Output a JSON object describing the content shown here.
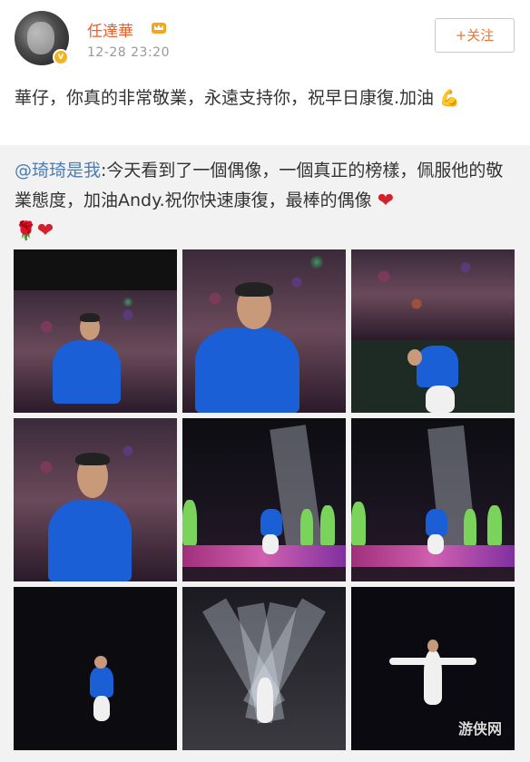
{
  "header": {
    "username": "任達華",
    "time": "12-28 23:20",
    "follow_label": "+关注",
    "verified_badge": "v",
    "crown_icon": "crown-icon"
  },
  "post": {
    "text": "華仔，你真的非常敬業，永遠支持你，祝早日康復.加油",
    "emoji": "💪"
  },
  "repost": {
    "mention": "@琦琦是我",
    "text": ":今天看到了一個偶像，一個真正的榜樣，佩服他的敬業態度，加油Andy.祝你快速康復，最棒的偶像",
    "heart": "❤",
    "rose": "🌹",
    "heart2": "❤"
  },
  "photos": [
    {
      "name": "photo-1",
      "scene": "blue-jacket-crowd"
    },
    {
      "name": "photo-2",
      "scene": "blue-jacket-closeup"
    },
    {
      "name": "photo-3",
      "scene": "bowing"
    },
    {
      "name": "photo-4",
      "scene": "praying-hands"
    },
    {
      "name": "photo-5",
      "scene": "stage-dancers"
    },
    {
      "name": "photo-6",
      "scene": "stage-dancers-2"
    },
    {
      "name": "photo-7",
      "scene": "dark-stage"
    },
    {
      "name": "photo-8",
      "scene": "spotlights"
    },
    {
      "name": "photo-9",
      "scene": "arms-spread"
    }
  ],
  "watermark": "游侠网",
  "colors": {
    "username": "#e8612c",
    "follow": "#ec7630",
    "mention": "#4f7cae",
    "repost_bg": "#f2f2f2"
  }
}
